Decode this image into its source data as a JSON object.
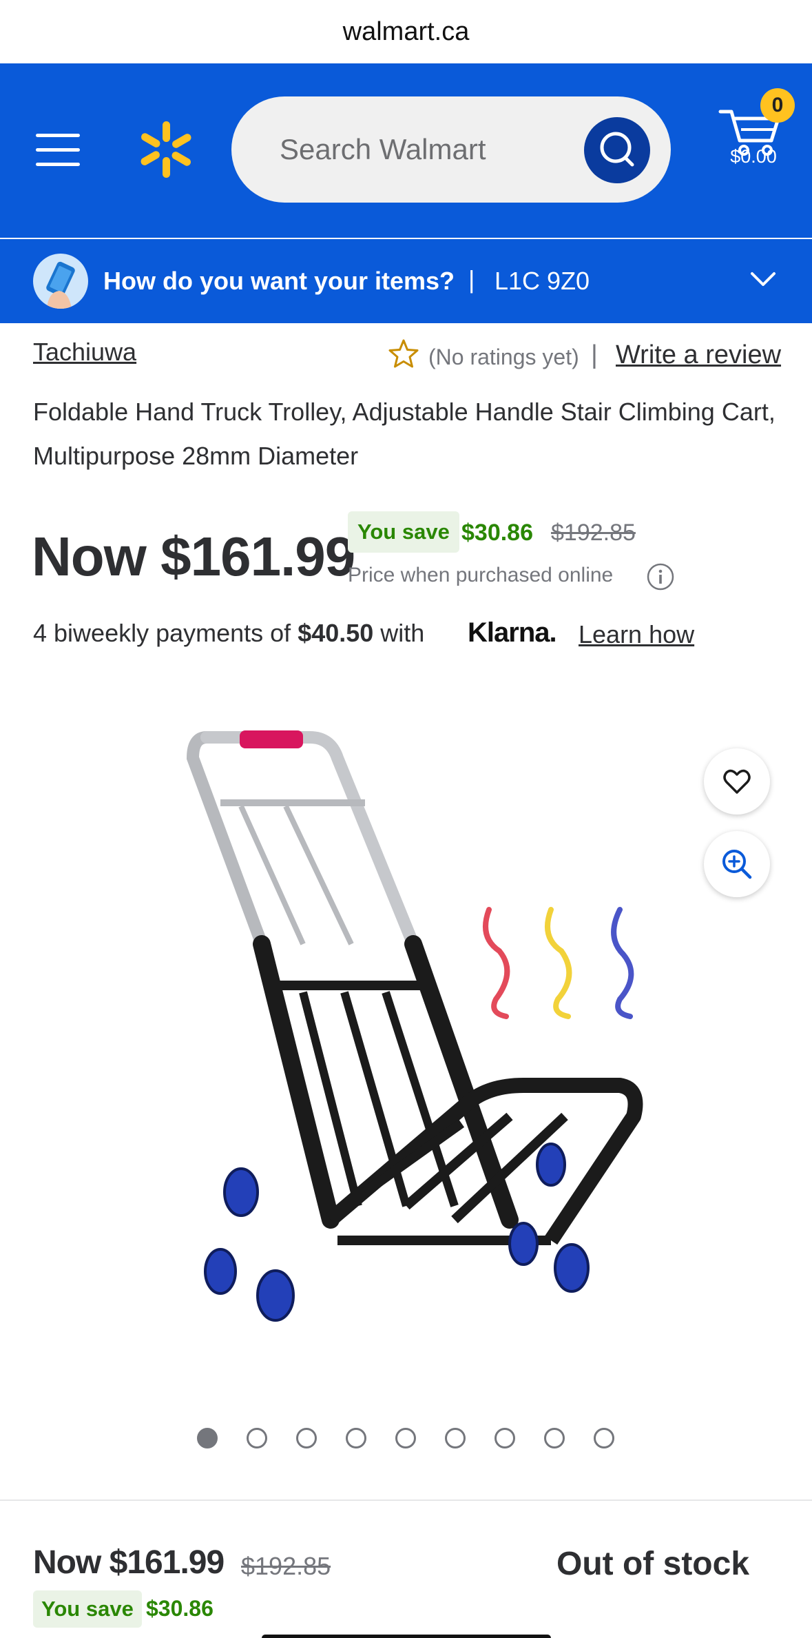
{
  "browser": {
    "url": "walmart.ca"
  },
  "header": {
    "search_placeholder": "Search Walmart",
    "cart_count": "0",
    "cart_total": "$0.00",
    "colors": {
      "header_bg": "#0a5ad9",
      "spark": "#ffc220",
      "search_button": "#0a3b9e"
    }
  },
  "delivery": {
    "question": "How do you want your items?",
    "separator": "|",
    "postal_code": "L1C 9Z0"
  },
  "product": {
    "brand": "Tachiuwa",
    "ratings_text": "(No ratings yet)",
    "ratings_separator": "|",
    "write_review": "Write a review",
    "title": "Foldable Hand Truck Trolley, Adjustable Handle Stair Climbing Cart, Multipurpose 28mm Diameter",
    "price_now": "Now $161.99",
    "you_save_label": "You save",
    "save_amount": "$30.86",
    "was_price": "$192.85",
    "online_note": "Price when purchased online",
    "klarna": {
      "prefix": "4 biweekly payments of ",
      "amount": "$40.50",
      "suffix": " with",
      "brand": "Klarna.",
      "learn_link": "Learn how"
    },
    "image_count": 9,
    "active_image": 1
  },
  "bottom_bar": {
    "price_now": "Now $161.99",
    "was_price": "$192.85",
    "you_save_label": "You save",
    "save_amount": "$30.86",
    "stock_status": "Out of stock"
  }
}
